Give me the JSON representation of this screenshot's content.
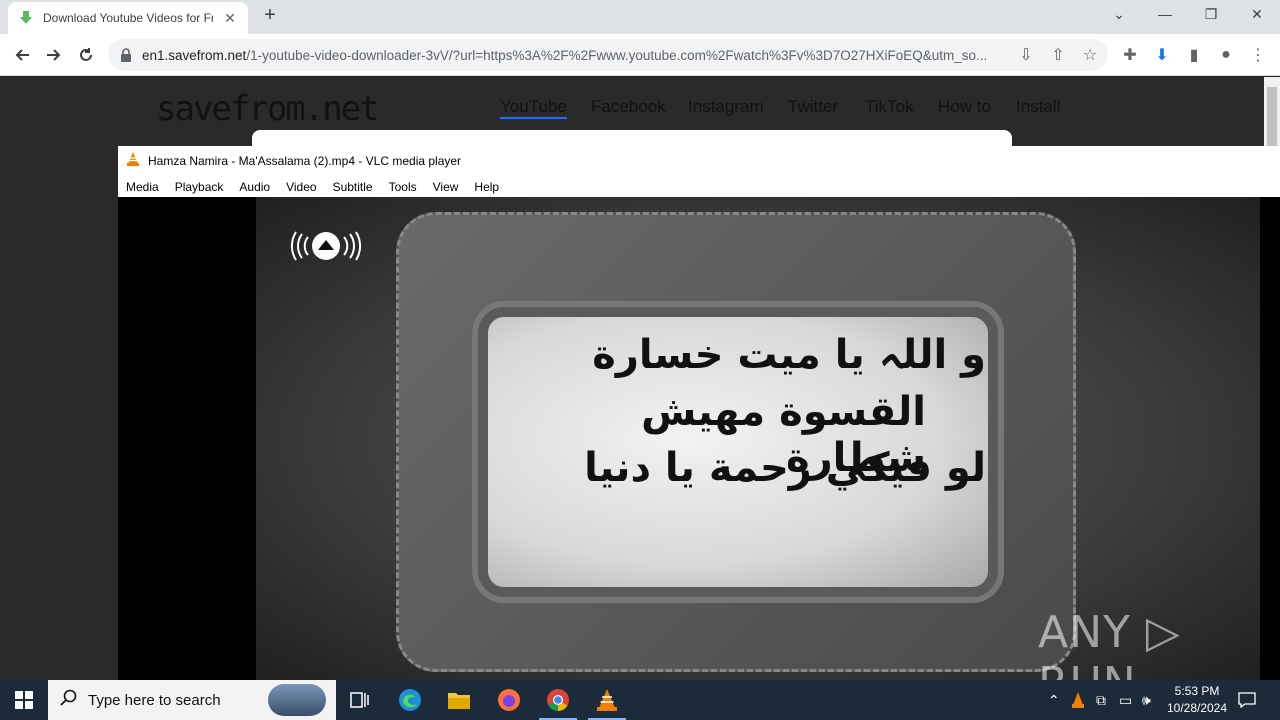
{
  "browser": {
    "tab_title": "Download Youtube Videos for Free",
    "tab_close": "✕",
    "new_tab": "+",
    "url_host": "en1.savefrom.net",
    "url_rest": "/1-youtube-video-downloader-3vV/?url=https%3A%2F%2Fwww.youtube.com%2Fwatch%3Fv%3D7O27HXiFoEQ&utm_so..."
  },
  "site": {
    "logo": "savefrom.net",
    "nav": [
      "YouTube",
      "Facebook",
      "Instagram",
      "Twitter",
      "TikTok",
      "How to",
      "Install"
    ]
  },
  "vlc": {
    "title": "Hamza Namira - Ma'Assalama  (2).mp4 - VLC media player",
    "menu": [
      "Media",
      "Playback",
      "Audio",
      "Video",
      "Subtitle",
      "Tools",
      "View",
      "Help"
    ],
    "lyrics": [
      "و اللہ يا ميت خسارة",
      "القسوة مهيش شطارة",
      "لو فيكي رحمة يا دنيا"
    ],
    "watermark": "ANY ▷ RUN"
  },
  "taskbar": {
    "search_placeholder": "Type here to search",
    "time": "5:53 PM",
    "date": "10/28/2024"
  }
}
